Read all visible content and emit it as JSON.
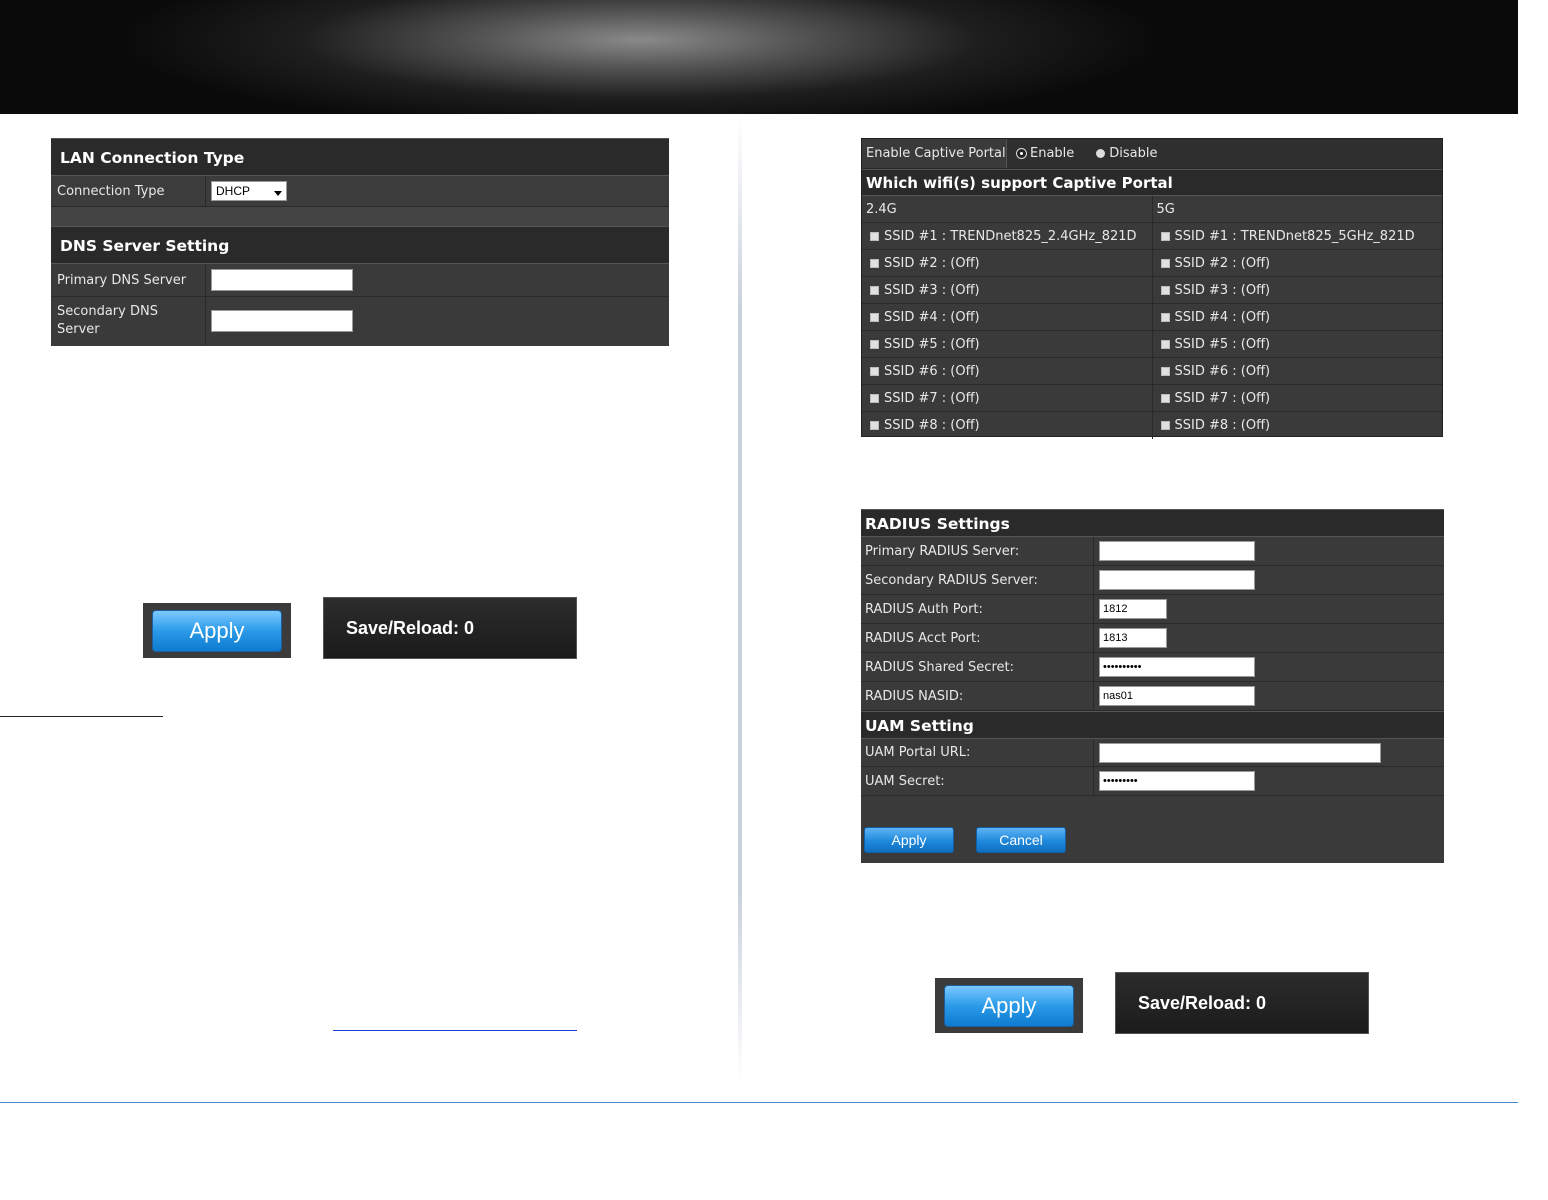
{
  "lan_panel": {
    "title": "LAN Connection Type",
    "connection_type_label": "Connection Type",
    "connection_type_value": "DHCP",
    "dns_title": "DNS Server Setting",
    "primary_dns_label": "Primary DNS Server",
    "primary_dns_value": "",
    "secondary_dns_label": "Secondary DNS Server",
    "secondary_dns_value": ""
  },
  "left_buttons": {
    "apply": "Apply",
    "save_reload": "Save/Reload: 0"
  },
  "captive_portal": {
    "enable_label": "Enable Captive Portal",
    "enable_option": "Enable",
    "disable_option": "Disable",
    "selected": "Enable",
    "wifi_title": "Which wifi(s) support Captive Portal",
    "band_24": "2.4G",
    "band_5": "5G",
    "ssids_24": [
      "SSID #1 : TRENDnet825_2.4GHz_821D",
      "SSID #2 : (Off)",
      "SSID #3 : (Off)",
      "SSID #4 : (Off)",
      "SSID #5 : (Off)",
      "SSID #6 : (Off)",
      "SSID #7 : (Off)",
      "SSID #8 : (Off)"
    ],
    "ssids_5": [
      "SSID #1 : TRENDnet825_5GHz_821D",
      "SSID #2 : (Off)",
      "SSID #3 : (Off)",
      "SSID #4 : (Off)",
      "SSID #5 : (Off)",
      "SSID #6 : (Off)",
      "SSID #7 : (Off)",
      "SSID #8 : (Off)"
    ]
  },
  "radius": {
    "title": "RADIUS Settings",
    "primary_label": "Primary RADIUS Server:",
    "primary_value": "",
    "secondary_label": "Secondary RADIUS Server:",
    "secondary_value": "",
    "auth_port_label": "RADIUS Auth Port:",
    "auth_port_value": "1812",
    "acct_port_label": "RADIUS Acct Port:",
    "acct_port_value": "1813",
    "secret_label": "RADIUS Shared Secret:",
    "secret_value": "••••••••••",
    "nasid_label": "RADIUS NASID:",
    "nasid_value": "nas01",
    "uam_title": "UAM Setting",
    "uam_url_label": "UAM Portal URL:",
    "uam_url_value": "",
    "uam_secret_label": "UAM Secret:",
    "uam_secret_value": "•••••••••",
    "apply": "Apply",
    "cancel": "Cancel"
  },
  "right_buttons": {
    "apply": "Apply",
    "save_reload": "Save/Reload: 0"
  }
}
